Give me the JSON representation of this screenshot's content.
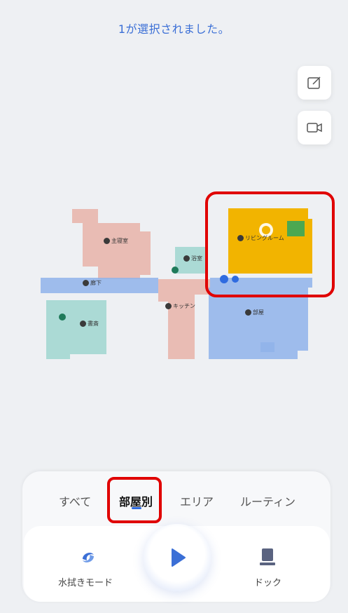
{
  "status_message": "1が選択されました。",
  "map": {
    "rooms": [
      {
        "id": "master-bedroom",
        "label": "主寝室",
        "color": "#e8b3a8"
      },
      {
        "id": "bathroom",
        "label": "浴室",
        "color": "#9fd6cf"
      },
      {
        "id": "living-room",
        "label": "リビングルーム",
        "color": "#f2b400",
        "selected": true
      },
      {
        "id": "hallway",
        "label": "廊下",
        "color": "#8fb3ea"
      },
      {
        "id": "kitchen",
        "label": "キッチン",
        "color": "#e8b3a8"
      },
      {
        "id": "study",
        "label": "書斎",
        "color": "#9fd6cf"
      },
      {
        "id": "room",
        "label": "部屋",
        "color": "#8fb3ea"
      }
    ]
  },
  "tabs": [
    {
      "label": "すべて",
      "active": false
    },
    {
      "label": "部屋別",
      "active": true
    },
    {
      "label": "エリア",
      "active": false
    },
    {
      "label": "ルーティン",
      "active": false
    }
  ],
  "actions": {
    "mop_mode_label": "水拭きモード",
    "dock_label": "ドック"
  },
  "icons": {
    "edit": "edit-map-icon",
    "video": "video-camera-icon",
    "mop": "mop-mode-icon",
    "play": "play-icon",
    "dock": "dock-icon"
  },
  "colors": {
    "accent": "#2f6be0",
    "highlight": "#e00000",
    "selected_room": "#f2b400"
  }
}
